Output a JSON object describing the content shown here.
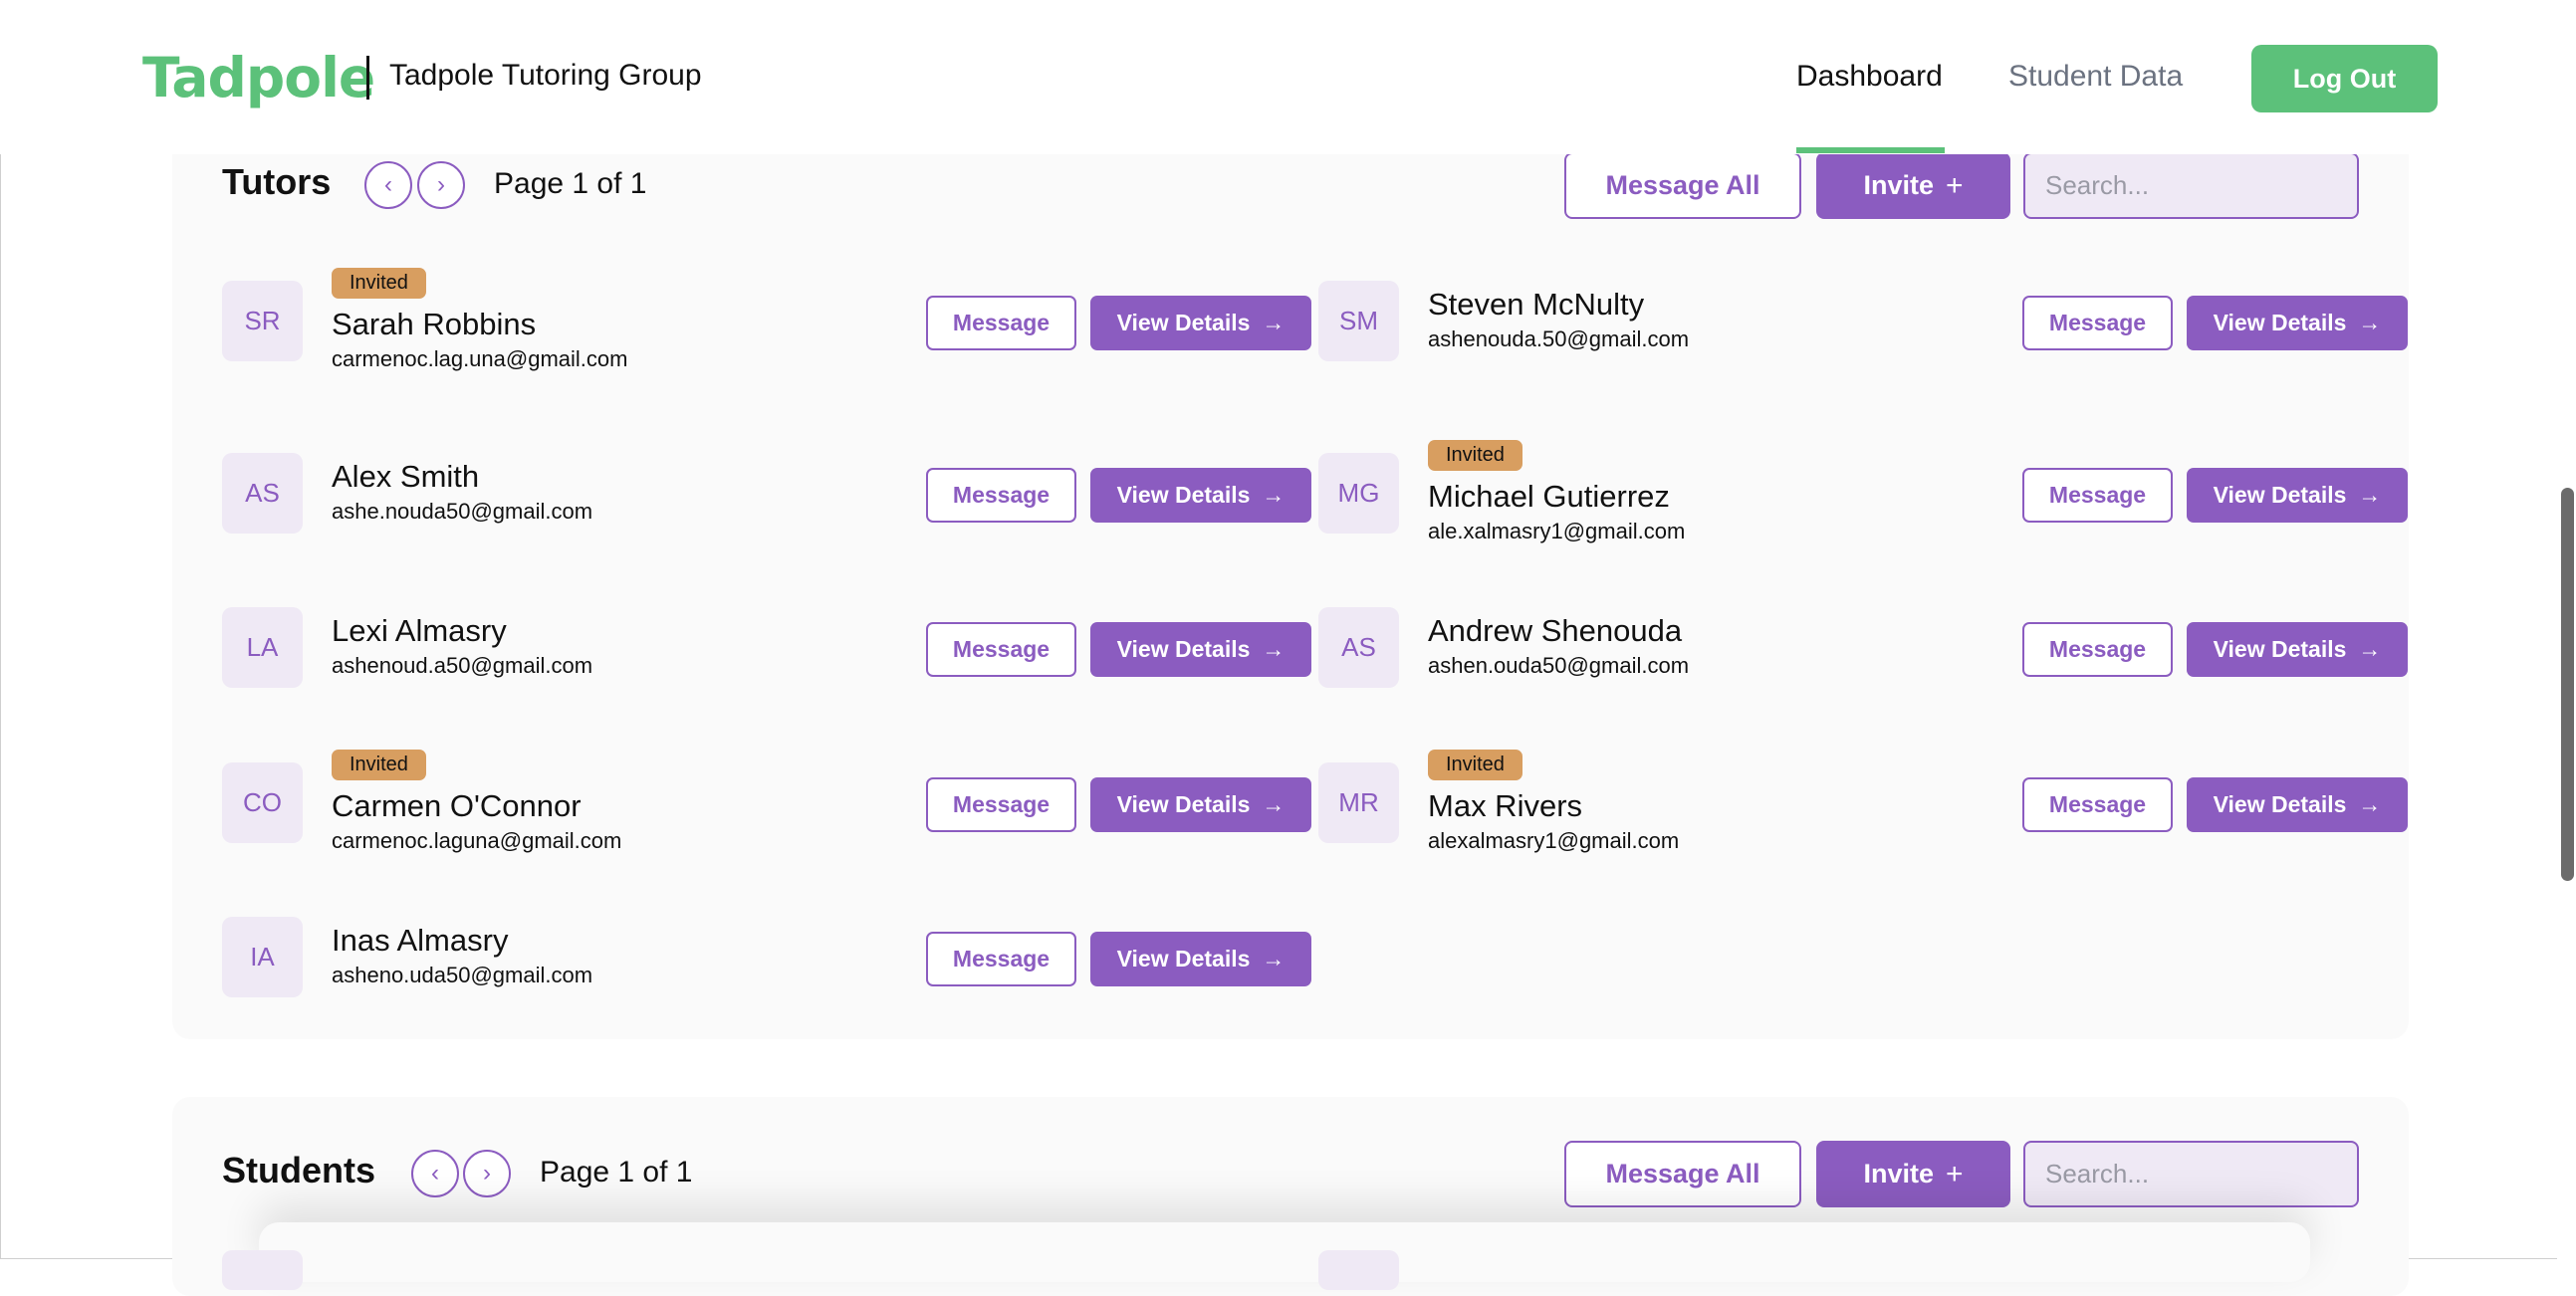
{
  "header": {
    "logo_text": "Tadpole",
    "org_name": "Tadpole Tutoring Group",
    "nav": {
      "dashboard": "Dashboard",
      "student_data": "Student Data",
      "active": "Dashboard"
    },
    "logout_label": "Log Out"
  },
  "tutors": {
    "title": "Tutors",
    "prev_icon": "‹",
    "next_icon": "›",
    "page_label": "Page 1 of 1",
    "message_all_label": "Message All",
    "invite_label": "Invite",
    "invite_icon": "+",
    "search_placeholder": "Search...",
    "message_label": "Message",
    "view_details_label": "View Details",
    "view_details_icon": "→",
    "items": [
      {
        "initials": "SR",
        "badge": "Invited",
        "name": "Sarah Robbins",
        "email": "carmenoc.lag.una@gmail.com"
      },
      {
        "initials": "SM",
        "badge": "",
        "name": "Steven McNulty",
        "email": "ashenouda.50@gmail.com"
      },
      {
        "initials": "AS",
        "badge": "",
        "name": "Alex Smith",
        "email": "ashe.nouda50@gmail.com"
      },
      {
        "initials": "MG",
        "badge": "Invited",
        "name": "Michael Gutierrez",
        "email": "ale.xalmasry1@gmail.com"
      },
      {
        "initials": "LA",
        "badge": "",
        "name": "Lexi Almasry",
        "email": "ashenoud.a50@gmail.com"
      },
      {
        "initials": "AS",
        "badge": "",
        "name": "Andrew Shenouda",
        "email": "ashen.ouda50@gmail.com"
      },
      {
        "initials": "CO",
        "badge": "Invited",
        "name": "Carmen O'Connor",
        "email": "carmenoc.laguna@gmail.com"
      },
      {
        "initials": "MR",
        "badge": "Invited",
        "name": "Max Rivers",
        "email": "alexalmasry1@gmail.com"
      },
      {
        "initials": "IA",
        "badge": "",
        "name": "Inas Almasry",
        "email": "asheno.uda50@gmail.com"
      }
    ]
  },
  "students": {
    "title": "Students",
    "prev_icon": "‹",
    "next_icon": "›",
    "page_label": "Page 1 of 1",
    "message_all_label": "Message All",
    "invite_label": "Invite",
    "invite_icon": "+",
    "search_placeholder": "Search..."
  },
  "colors": {
    "brand_green": "#5cc17a",
    "accent_purple": "#8b5cc0",
    "avatar_bg": "#efe9f5",
    "badge_orange": "#d89e60",
    "panel_bg": "#fafafa"
  }
}
